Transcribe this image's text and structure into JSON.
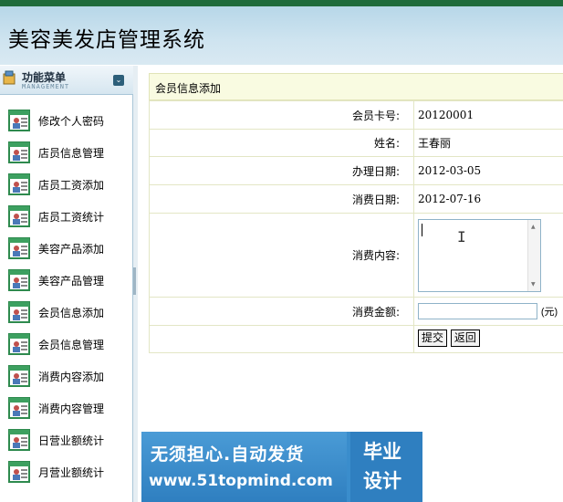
{
  "header": {
    "title": "美容美发店管理系统"
  },
  "sidebar": {
    "menu_title": "功能菜单",
    "menu_subtitle": "MANAGEMENT",
    "items": [
      {
        "label": "修改个人密码"
      },
      {
        "label": "店员信息管理"
      },
      {
        "label": "店员工资添加"
      },
      {
        "label": "店员工资统计"
      },
      {
        "label": "美容产品添加"
      },
      {
        "label": "美容产品管理"
      },
      {
        "label": "会员信息添加"
      },
      {
        "label": "会员信息管理"
      },
      {
        "label": "消费内容添加"
      },
      {
        "label": "消费内容管理"
      },
      {
        "label": "日营业额统计"
      },
      {
        "label": "月营业额统计"
      }
    ]
  },
  "form": {
    "title": "会员信息添加",
    "fields": {
      "card_label": "会员卡号:",
      "card_value": "20120001",
      "name_label": "姓名:",
      "name_value": "王春丽",
      "join_date_label": "办理日期:",
      "join_date_value": "2012-03-05",
      "consume_date_label": "消费日期:",
      "consume_date_value": "2012-07-16",
      "content_label": "消费内容:",
      "content_value": "",
      "amount_label": "消费金额:",
      "amount_value": "",
      "amount_unit": "(元)"
    },
    "submit_label": "提交",
    "back_label": "返回"
  },
  "watermark": {
    "line1": "无须担心.自动发货",
    "line2": "www.51topmind.com",
    "right1": "毕业",
    "right2": "设计"
  }
}
